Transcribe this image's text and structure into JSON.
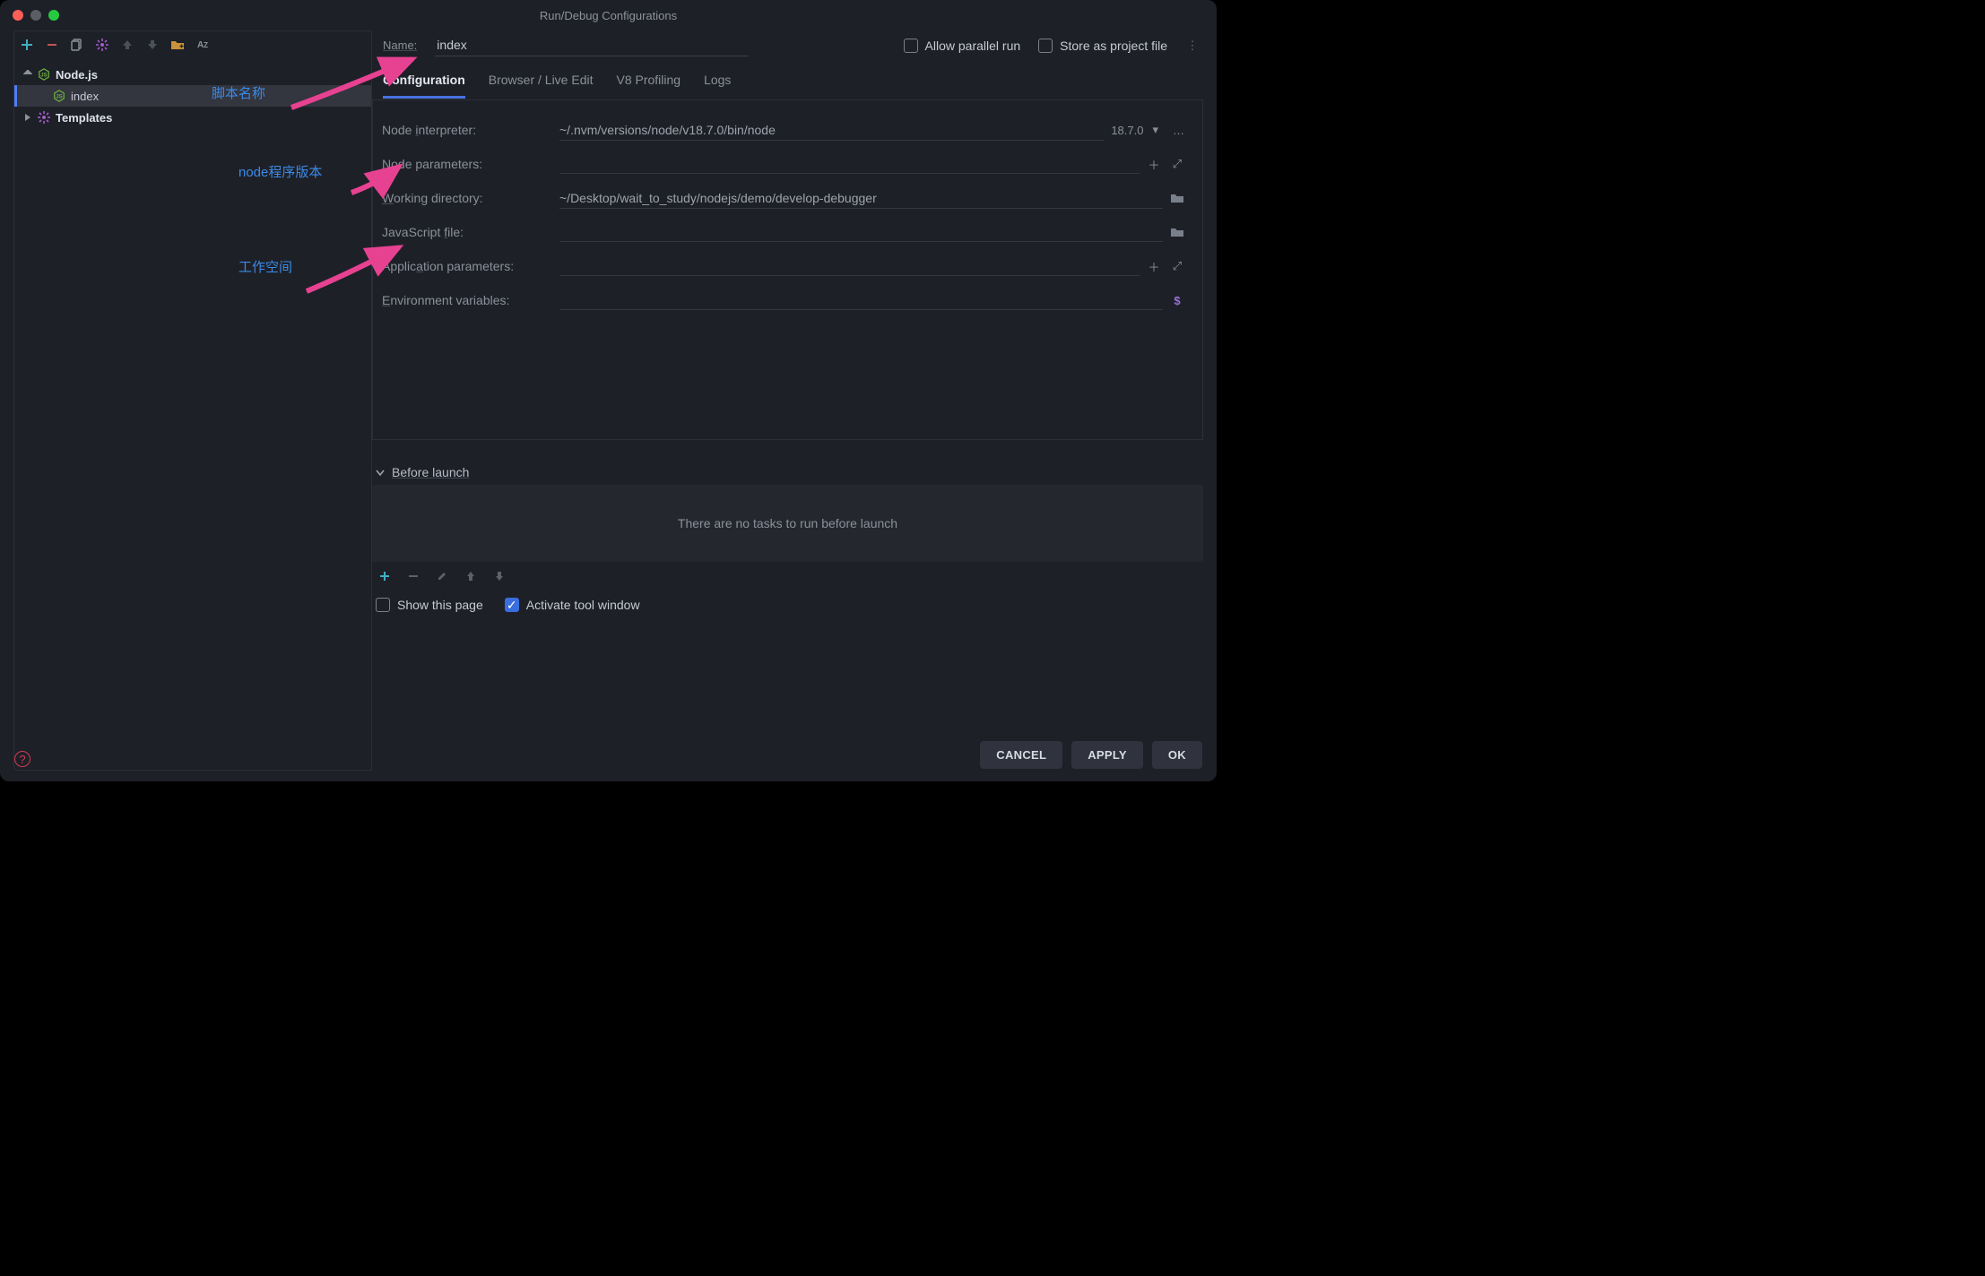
{
  "titlebar": {
    "title": "Run/Debug Configurations"
  },
  "sidebar": {
    "items": [
      {
        "label": "Node.js"
      },
      {
        "label": "index"
      },
      {
        "label": "Templates"
      }
    ]
  },
  "top": {
    "name_label": "Name:",
    "name_value": "index",
    "allow_parallel": "Allow parallel run",
    "store_as": "Store as project file"
  },
  "tabs": {
    "configuration": "Configuration",
    "browser": "Browser / Live Edit",
    "v8": "V8 Profiling",
    "logs": "Logs"
  },
  "form": {
    "node_interpreter_label": "Node interpreter:",
    "node_interpreter_value": "~/.nvm/versions/node/v18.7.0/bin/node",
    "node_interpreter_version": "18.7.0",
    "node_params_label": "Node parameters:",
    "working_dir_label": "Working directory:",
    "working_dir_value": "~/Desktop/wait_to_study/nodejs/demo/develop-debugger",
    "js_file_label": "JavaScript file:",
    "app_params_label": "Application parameters:",
    "env_vars_label": "Environment variables:"
  },
  "before": {
    "header": "Before launch",
    "empty": "There are no tasks to run before launch"
  },
  "bottom": {
    "show_page": "Show this page",
    "activate_tool": "Activate tool window"
  },
  "footer": {
    "cancel": "CANCEL",
    "apply": "APPLY",
    "ok": "OK"
  },
  "annotations": {
    "script_name": "脚本名称",
    "node_version": "node程序版本",
    "workspace": "工作空间"
  }
}
